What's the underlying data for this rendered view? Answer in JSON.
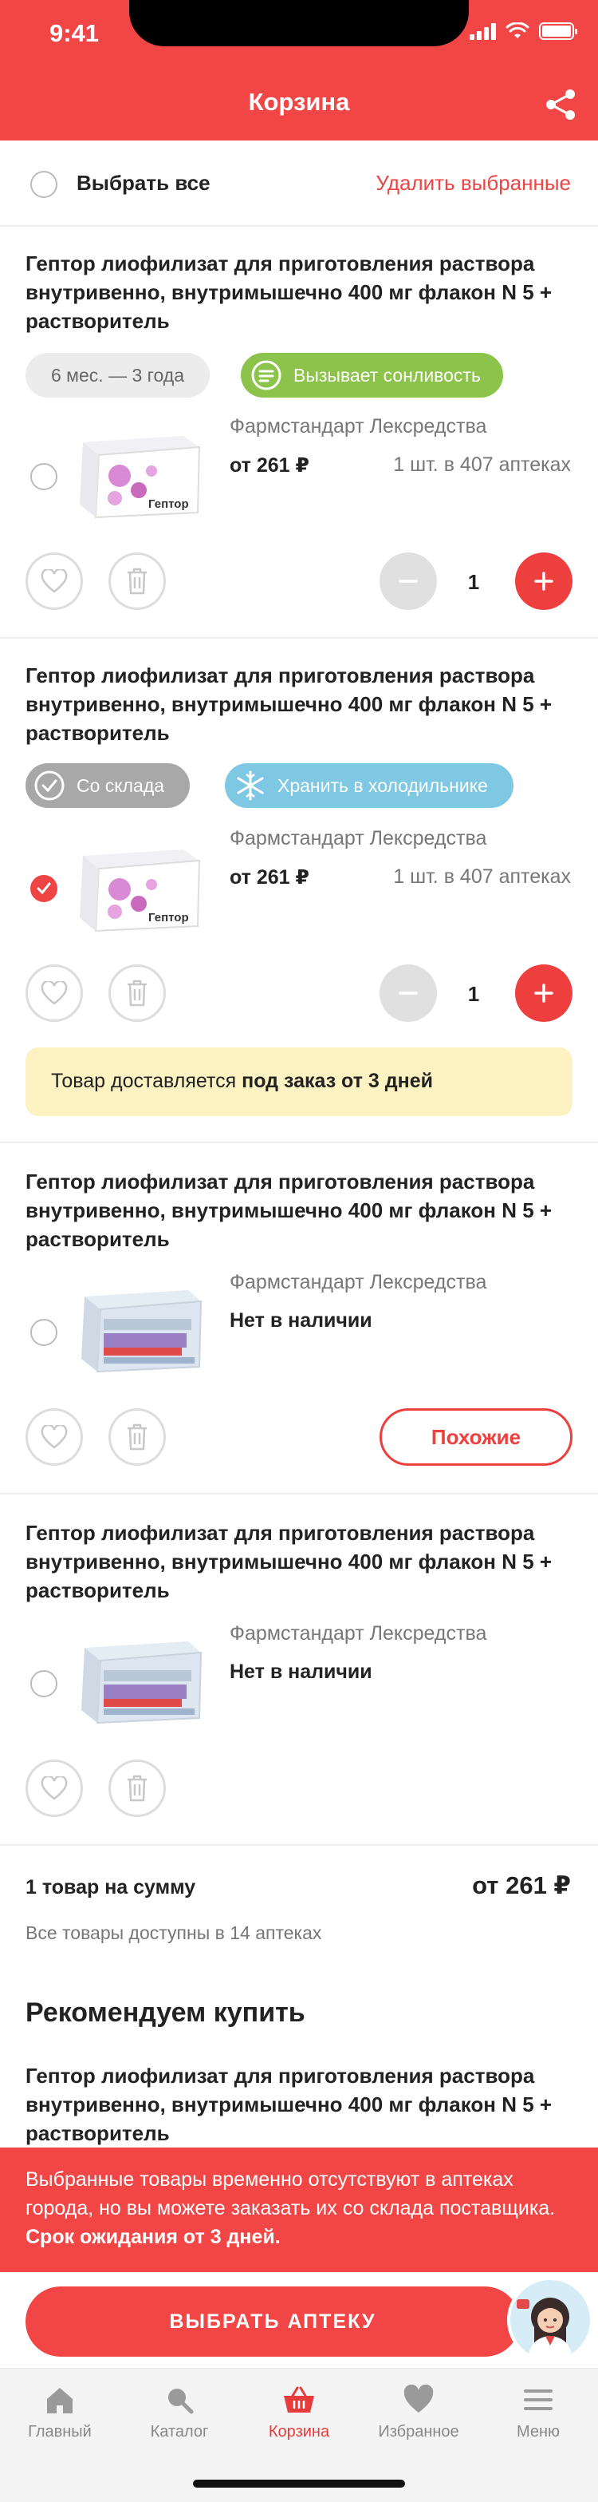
{
  "status_bar": {
    "time": "9:41"
  },
  "header": {
    "title": "Корзина",
    "share_icon": "share-icon"
  },
  "select_all": {
    "label": "Выбрать все",
    "delete_label": "Удалить выбранные"
  },
  "products": [
    {
      "title": "Гептор лиофилизат для приготовления раствора внутривенно, внутримышечно 400 мг флакон N 5 + растворитель",
      "chips": [
        {
          "label": "6 мес. — 3 года"
        },
        {
          "label": "Вызывает сонливость"
        }
      ],
      "product_label": "Гептор",
      "manufacturer": "Фармстандарт Лексредства",
      "price": "от 261 ₽",
      "availability": "1 шт. в 407 аптеках",
      "quantity": "1",
      "checked": false
    },
    {
      "title": "Гептор лиофилизат для приготовления раствора внутривенно, внутримышечно 400 мг флакон N 5 + растворитель",
      "chips": [
        {
          "label": "Со склада"
        },
        {
          "label": "Хранить в холодильнике"
        }
      ],
      "product_label": "Гептор",
      "manufacturer": "Фармстандарт Лексредства",
      "price": "от 261 ₽",
      "availability": "1 шт. в 407 аптеках",
      "quantity": "1",
      "checked": true,
      "notice": {
        "text": "Товар доставляется ",
        "bold": "под заказ от 3 дней"
      }
    },
    {
      "title": "Гептор лиофилизат для приготовления раствора внутривенно, внутримышечно 400 мг флакон N 5 + растворитель",
      "manufacturer": "Фармстандарт Лексредства",
      "stock": "Нет в наличии",
      "similar_label": "Похожие",
      "checked": false
    },
    {
      "title": "Гептор лиофилизат для приготовления раствора внутривенно, внутримышечно 400 мг флакон N 5 + растворитель",
      "manufacturer": "Фармстандарт Лексредства",
      "stock": "Нет в наличии",
      "checked": false
    }
  ],
  "summary": {
    "label": "1 товар на сумму",
    "total": "от 261 ₽",
    "sub": "Все товары доступны в 14 аптеках"
  },
  "recommend": {
    "heading": "Рекомендуем купить",
    "title": "Гептор лиофилизат для приготовления раствора внутривенно, внутримышечно 400 мг флакон N 5 + растворитель"
  },
  "warning": {
    "text": "Выбранные товары временно отсутствуют в аптеках города, но вы можете заказать их со склада поставщика. ",
    "bold": "Срок ожидания от 3 дней."
  },
  "action": {
    "choose_label": "ВЫБРАТЬ АПТЕКУ"
  },
  "tabbar": {
    "items": [
      {
        "label": "Главный",
        "icon": "home-icon"
      },
      {
        "label": "Каталог",
        "icon": "search-icon"
      },
      {
        "label": "Корзина",
        "icon": "basket-icon",
        "active": true
      },
      {
        "label": "Избранное",
        "icon": "heart-icon"
      },
      {
        "label": "Меню",
        "icon": "menu-icon"
      }
    ]
  },
  "colors": {
    "brand": "#f24646",
    "chip_green": "#8cc34a",
    "chip_blue": "#7ec8e3",
    "notice_bg": "#fdf3c2"
  }
}
